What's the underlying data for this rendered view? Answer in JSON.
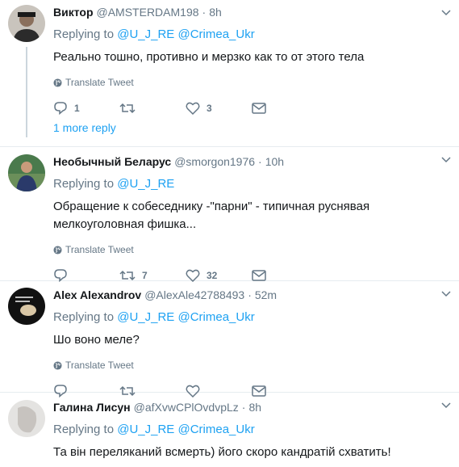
{
  "colors": {
    "accent": "#1da1f2",
    "muted": "#657786",
    "border": "#e6ecf0"
  },
  "tweets": [
    {
      "fullname": "Виктор",
      "username": "@AMSTERDAM198",
      "time": "8h",
      "replying_prefix": "Replying to",
      "mentions": [
        "@U_J_RE",
        "@Crimea_Ukr"
      ],
      "text": "Реально тошно, противно и мерзко как то от этого тела",
      "translate": "Translate Tweet",
      "reply_count": "1",
      "retweet_count": "",
      "like_count": "3",
      "more_replies": "1 more reply"
    },
    {
      "fullname": "Необычный Беларус",
      "username": "@smorgon1976",
      "time": "10h",
      "replying_prefix": "Replying to",
      "mentions": [
        "@U_J_RE"
      ],
      "text": "Обращение к собеседнику -\"парни\" - типичная руснявая мелкоуголовная фишка...",
      "translate": "Translate Tweet",
      "reply_count": "",
      "retweet_count": "7",
      "like_count": "32"
    },
    {
      "fullname": "Alex Alexandrov",
      "username": "@AlexAle42788493",
      "time": "52m",
      "replying_prefix": "Replying to",
      "mentions": [
        "@U_J_RE",
        "@Crimea_Ukr"
      ],
      "text": "Шо воно меле?",
      "translate": "Translate Tweet",
      "reply_count": "",
      "retweet_count": "",
      "like_count": ""
    },
    {
      "fullname": "Галина Лисун",
      "username": "@afXvwCPlOvdvpLz",
      "time": "8h",
      "replying_prefix": "Replying to",
      "mentions": [
        "@U_J_RE",
        "@Crimea_Ukr"
      ],
      "text": "Та він переляканий всмерть) його скоро кандратій схватить!"
    }
  ]
}
